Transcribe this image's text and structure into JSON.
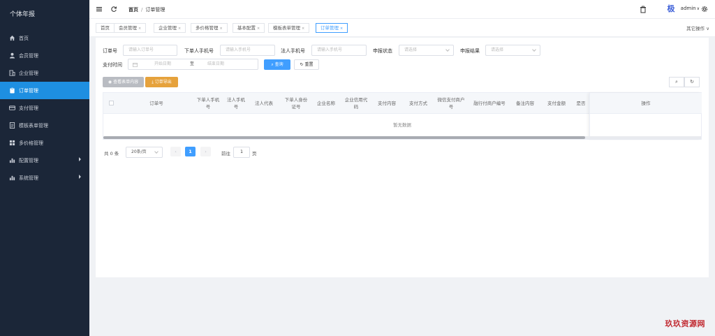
{
  "app": {
    "title": "个体年报"
  },
  "sidebar": {
    "items": [
      {
        "label": "首页",
        "icon": "home-icon",
        "active": false,
        "has_children": false
      },
      {
        "label": "会员管理",
        "icon": "user-icon",
        "active": false,
        "has_children": false
      },
      {
        "label": "企业管理",
        "icon": "building-icon",
        "active": false,
        "has_children": false
      },
      {
        "label": "订单管理",
        "icon": "clipboard-icon",
        "active": true,
        "has_children": false
      },
      {
        "label": "支付管理",
        "icon": "card-icon",
        "active": false,
        "has_children": false
      },
      {
        "label": "模板表单管理",
        "icon": "document-icon",
        "active": false,
        "has_children": false
      },
      {
        "label": "多价格管理",
        "icon": "grid-icon",
        "active": false,
        "has_children": false
      },
      {
        "label": "配置管理",
        "icon": "bar-chart-icon",
        "active": false,
        "has_children": true
      },
      {
        "label": "系统管理",
        "icon": "bar-chart-icon",
        "active": false,
        "has_children": true
      }
    ]
  },
  "header": {
    "breadcrumb_home": "首页",
    "breadcrumb_sep": "/",
    "breadcrumb_current": "订单管理",
    "user_name": "admin",
    "user_caret": "∨",
    "avatar_char": "极"
  },
  "tabs": {
    "items": [
      {
        "label": "首页",
        "chev": "",
        "active": false
      },
      {
        "label": "会员管理",
        "chev": "×",
        "active": false
      },
      {
        "label": "企业管理",
        "chev": "×",
        "active": false
      },
      {
        "label": "多价格管理",
        "chev": "×",
        "active": false
      },
      {
        "label": "基本配置",
        "chev": "×",
        "active": false
      },
      {
        "label": "模板表单管理",
        "chev": "×",
        "active": false
      },
      {
        "label": "订单管理",
        "chev": "×",
        "active": true
      }
    ],
    "other_ops": "其它操作 ∨"
  },
  "search": {
    "order_no_label": "订单号",
    "order_no_placeholder": "请输入订单号",
    "buyer_phone_label": "下单人手机号",
    "buyer_phone_placeholder": "请输入手机号",
    "legal_phone_label": "法人手机号",
    "legal_phone_placeholder": "请输入手机号",
    "report_status_label": "申报状态",
    "report_status_placeholder": "请选择",
    "report_result_label": "申报结果",
    "report_result_placeholder": "请选择",
    "pay_time_label": "支付时间",
    "start_date_placeholder": "开始日期",
    "date_sep": "至",
    "end_date_placeholder": "结束日期",
    "search_button": "查询",
    "reset_button": "重置"
  },
  "toolbar": {
    "view_form_button": "查看表单内容",
    "export_button": "订单导出"
  },
  "table": {
    "columns": [
      "订单号",
      "下单人手机号",
      "法人手机号",
      "法人代表",
      "下单人身份证号",
      "企业名称",
      "企业信用代码",
      "支付内容",
      "支付方式",
      "微信支付商户号",
      "融行付商户编号",
      "备注内容",
      "支付金额",
      "是否"
    ],
    "action_column": "操作",
    "empty_text": "暂无数据"
  },
  "pagination": {
    "total": "共 0 条",
    "page_size": "20条/页",
    "current_page": "1",
    "goto_label": "前往",
    "goto_value": "1",
    "page_suffix": "页"
  },
  "watermark": "玖玖资源网",
  "colors": {
    "sidebar_bg": "#1b2638",
    "accent": "#409eff",
    "active_menu": "#1e8fe1",
    "warning": "#e6a23c"
  }
}
